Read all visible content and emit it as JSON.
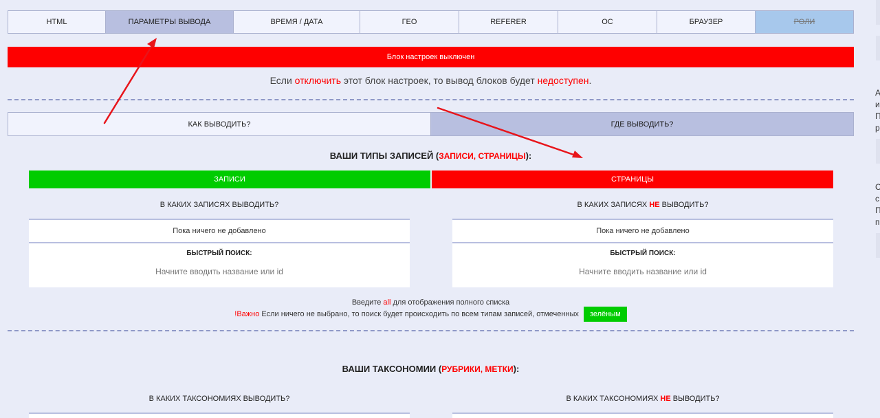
{
  "tabs": [
    {
      "label": "HTML",
      "state": "normal"
    },
    {
      "label": "ПАРАМЕТРЫ ВЫВОДА",
      "state": "active"
    },
    {
      "label": "ВРЕМЯ / ДАТА",
      "state": "normal"
    },
    {
      "label": "ГЕО",
      "state": "normal"
    },
    {
      "label": "REFERER",
      "state": "normal"
    },
    {
      "label": "ОС",
      "state": "normal"
    },
    {
      "label": "БРАУЗЕР",
      "state": "normal"
    },
    {
      "label": "РОЛИ",
      "state": "disabled"
    }
  ],
  "status_bar": {
    "text": "Блок настроек выключен",
    "color": "#fe0000"
  },
  "info": {
    "part1": "Если ",
    "link1": "отключить",
    "part2": " этот блок настроек, то вывод блоков будет ",
    "link2": "недоступен",
    "part3": "."
  },
  "mode_tabs": {
    "how": "КАК ВЫВОДИТЬ?",
    "where": "ГДЕ ВЫВОДИТЬ?"
  },
  "post_types": {
    "title_prefix": "ВАШИ ТИПЫ ЗАПИСЕЙ (",
    "title_red": "ЗАПИСИ, СТРАНИЦЫ",
    "title_suffix": "):",
    "green_label": "ЗАПИСИ",
    "red_label": "СТРАНИЦЫ",
    "include_head": "В КАКИХ ЗАПИСЯХ ВЫВОДИТЬ?",
    "exclude_head_pre": "В КАКИХ ЗАПИСЯХ ",
    "exclude_head_ne": "НЕ",
    "exclude_head_post": " ВЫВОДИТЬ?"
  },
  "box": {
    "empty_text": "Пока ничего не добавлено",
    "quick_search_label": "БЫСТРЫЙ ПОИСК:",
    "search_placeholder": "Начните вводить название или id"
  },
  "hint": {
    "line1_pre": "Введите ",
    "line1_all": "all",
    "line1_post": " для отображения полного списка",
    "important_label": "!Важно",
    "line2_text": " Если ничего не выбрано, то поиск будет происходить по всем типам записей, отмеченных ",
    "green_chip": "зелёным"
  },
  "taxonomies": {
    "title_prefix": "ВАШИ ТАКСОНОМИИ (",
    "title_red": "РУБРИКИ, МЕТКИ",
    "title_suffix": "):",
    "include_head": "В КАКИХ ТАКСОНОМИЯХ ВЫВОДИТЬ?",
    "exclude_head_pre": "В КАКИХ ТАКСОНОМИЯХ ",
    "exclude_head_ne": "НЕ",
    "exclude_head_post": " ВЫВОДИТЬ?"
  },
  "right_edge_letters": [
    "А",
    "и",
    "П",
    "р",
    "С",
    "с",
    "П",
    "п"
  ],
  "colors": {
    "page_bg": "#e9ecf8",
    "accent_red": "#fe0000",
    "accent_green": "#00cc00",
    "active_tab": "#b8bfe0",
    "roles_tab": "#a7c8ec",
    "annotation_arrow": "#e8141a"
  }
}
